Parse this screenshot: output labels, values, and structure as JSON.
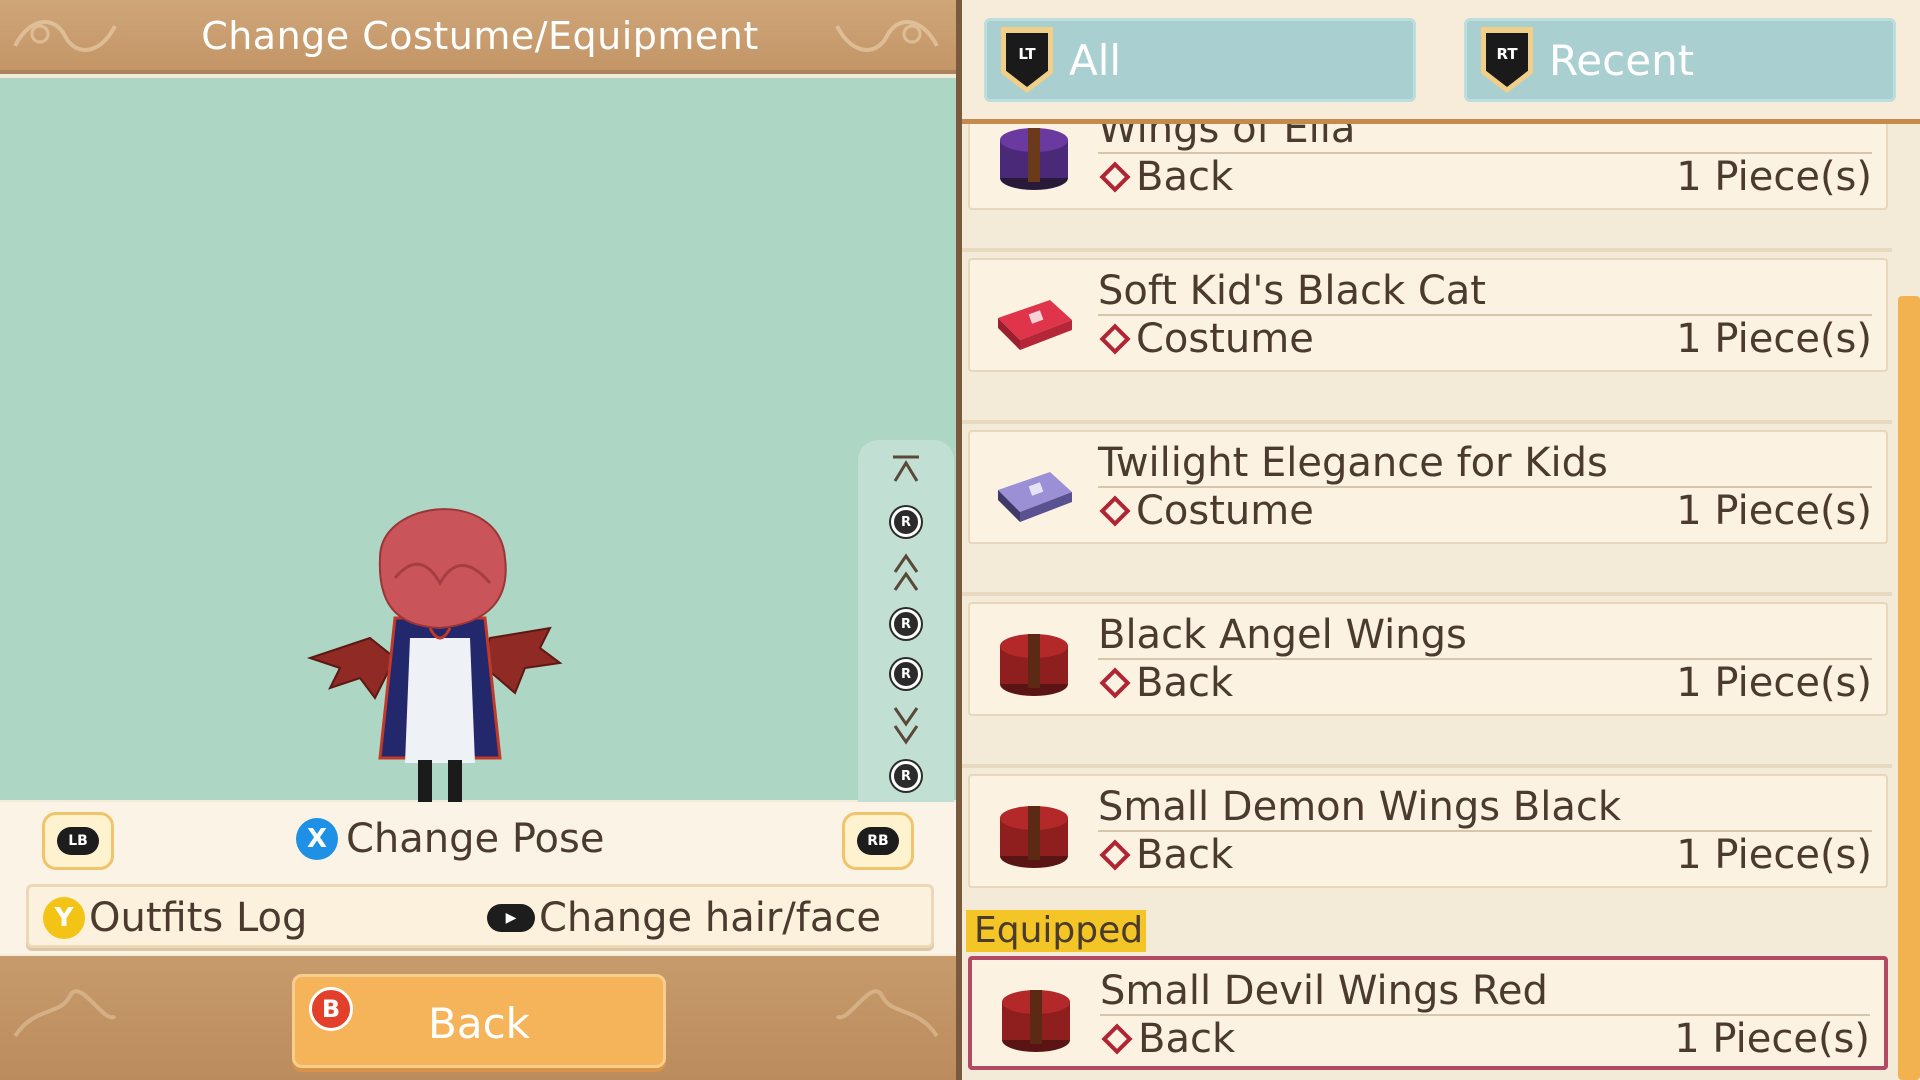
{
  "header": {
    "title": "Change Costume/Equipment"
  },
  "camera_controls": {
    "button_letter": "R",
    "icons": [
      "jump-to-top-icon",
      "r-stick-up-icon",
      "zoom-up-icon",
      "r-stick-left-icon",
      "r-stick-right-icon",
      "zoom-down-icon",
      "r-stick-down-icon",
      "jump-to-bottom-icon"
    ]
  },
  "controls": {
    "lb_label": "LB",
    "rb_label": "RB",
    "change_pose_button": "X",
    "change_pose_label": "Change Pose",
    "outfits_log_button": "Y",
    "outfits_log_label": "Outfits Log",
    "change_hair_label": "Change hair/face"
  },
  "footer": {
    "back_button": "B",
    "back_label": "Back"
  },
  "tabs": [
    {
      "button": "LT",
      "label": "All"
    },
    {
      "button": "RT",
      "label": "Recent"
    }
  ],
  "items": [
    {
      "name": "Wings of Ella",
      "type": "Back",
      "quantity": "1 Piece(s)",
      "icon": "red-hatbox-icon",
      "partially_visible": true
    },
    {
      "name": "Soft Kid's Black Cat",
      "type": "Costume",
      "quantity": "1 Piece(s)",
      "icon": "red-suitcase-icon"
    },
    {
      "name": "Twilight Elegance for Kids",
      "type": "Costume",
      "quantity": "1 Piece(s)",
      "icon": "purple-suitcase-icon"
    },
    {
      "name": "Black Angel Wings",
      "type": "Back",
      "quantity": "1 Piece(s)",
      "icon": "red-hatbox-icon"
    },
    {
      "name": "Small Demon Wings Black",
      "type": "Back",
      "quantity": "1 Piece(s)",
      "icon": "red-hatbox-icon"
    },
    {
      "name": "Small Devil Wings Red",
      "type": "Back",
      "quantity": "1 Piece(s)",
      "icon": "red-hatbox-icon",
      "equipped": true
    }
  ],
  "equipped_label": "Equipped",
  "colors": {
    "accent_orange": "#f2b24f",
    "tab_blue": "#a9cfd0",
    "preview_bg": "#aed6c4",
    "equipped_yellow": "#f3c526",
    "equipped_border": "#b24a63",
    "diamond_red": "#b02434"
  }
}
